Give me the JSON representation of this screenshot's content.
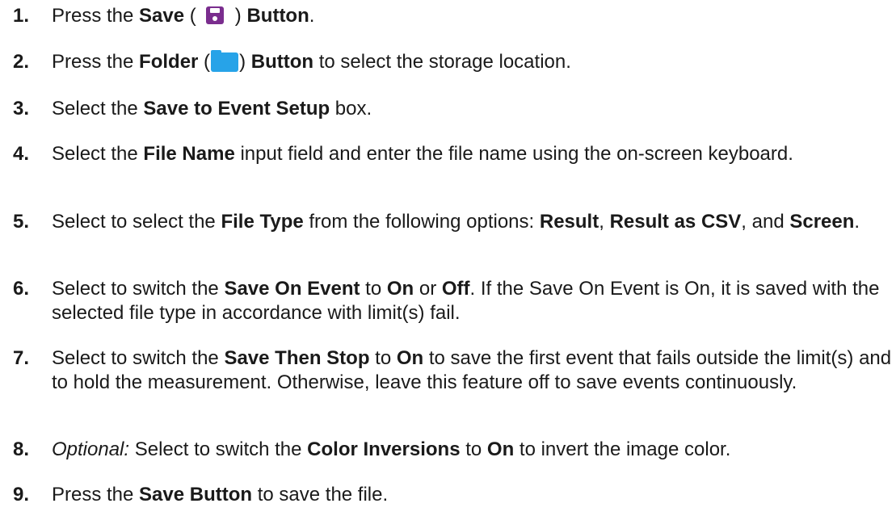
{
  "steps": [
    {
      "number": "1.",
      "parts": [
        {
          "text": "Press the "
        },
        {
          "text": "Save",
          "bold": true
        },
        {
          "text": " ("
        },
        {
          "icon": "save-icon"
        },
        {
          "text": ") "
        },
        {
          "text": "Button",
          "bold": true
        },
        {
          "text": "."
        }
      ]
    },
    {
      "number": "2.",
      "parts": [
        {
          "text": "Press the "
        },
        {
          "text": "Folder",
          "bold": true
        },
        {
          "text": " ("
        },
        {
          "icon": "folder-icon"
        },
        {
          "text": ") "
        },
        {
          "text": "Button",
          "bold": true
        },
        {
          "text": " to select the storage location."
        }
      ]
    },
    {
      "number": "3.",
      "parts": [
        {
          "text": "Select the "
        },
        {
          "text": "Save to Event Setup",
          "bold": true
        },
        {
          "text": " box."
        }
      ]
    },
    {
      "number": "4.",
      "parts": [
        {
          "text": "Select the "
        },
        {
          "text": "File Name",
          "bold": true
        },
        {
          "text": " input field and enter the file name using the on-screen keyboard."
        }
      ]
    },
    {
      "number": "5.",
      "parts": [
        {
          "text": "Select to select the "
        },
        {
          "text": "File Type",
          "bold": true
        },
        {
          "text": " from the following options: "
        },
        {
          "text": "Result",
          "bold": true
        },
        {
          "text": ", "
        },
        {
          "text": "Result as CSV",
          "bold": true
        },
        {
          "text": ", and "
        },
        {
          "text": "Screen",
          "bold": true
        },
        {
          "text": "."
        }
      ]
    },
    {
      "number": "6.",
      "parts": [
        {
          "text": "Select to switch the "
        },
        {
          "text": "Save On Event",
          "bold": true
        },
        {
          "text": " to "
        },
        {
          "text": "On",
          "bold": true
        },
        {
          "text": " or "
        },
        {
          "text": "Off",
          "bold": true
        },
        {
          "text": ". If the Save On Event is On, it is saved with the selected file type in accordance with limit(s) fail."
        }
      ]
    },
    {
      "number": "7.",
      "parts": [
        {
          "text": "Select to switch the "
        },
        {
          "text": "Save Then Stop",
          "bold": true
        },
        {
          "text": " to "
        },
        {
          "text": "On",
          "bold": true
        },
        {
          "text": " to save the first event that fails outside the limit(s) and to hold the measurement. Otherwise, leave this feature off to save events continuously."
        }
      ]
    },
    {
      "number": "8.",
      "parts": [
        {
          "text": "Optional:",
          "italic": true
        },
        {
          "text": " Select to switch the "
        },
        {
          "text": "Color Inversions",
          "bold": true
        },
        {
          "text": " to "
        },
        {
          "text": "On",
          "bold": true
        },
        {
          "text": " to invert the image color."
        }
      ]
    },
    {
      "number": "9.",
      "parts": [
        {
          "text": "Press the "
        },
        {
          "text": "Save Button",
          "bold": true
        },
        {
          "text": " to save the file."
        }
      ]
    }
  ]
}
